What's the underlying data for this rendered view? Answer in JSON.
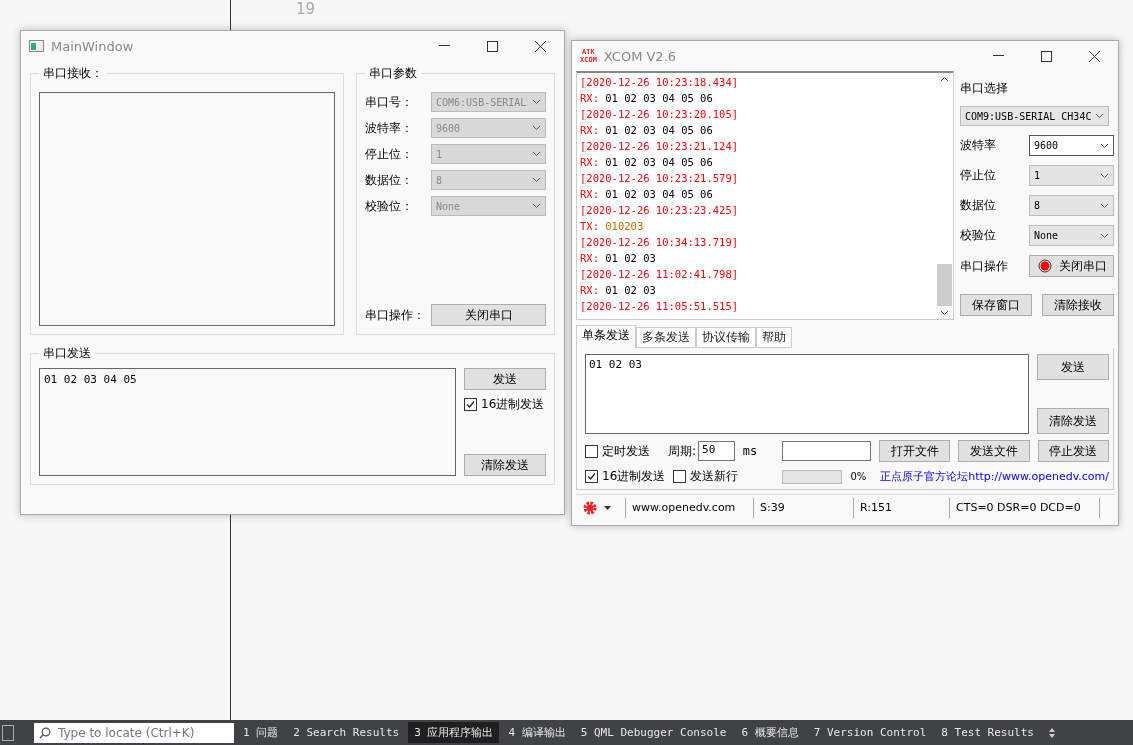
{
  "editor": {
    "line_number": "19"
  },
  "main_window": {
    "title": "MainWindow",
    "receive": {
      "title": "串口接收："
    },
    "params": {
      "title": "串口参数",
      "fields": [
        {
          "label": "串口号：",
          "value": "COM6:USB-SERIAL",
          "disabled": true
        },
        {
          "label": "波特率：",
          "value": "9600",
          "disabled": true
        },
        {
          "label": "停止位：",
          "value": "1",
          "disabled": true
        },
        {
          "label": "数据位：",
          "value": "8",
          "disabled": true
        },
        {
          "label": "校验位：",
          "value": "None",
          "disabled": true
        }
      ],
      "operation_label": "串口操作：",
      "operation_button": "关闭串口"
    },
    "send": {
      "title": "串口发送",
      "value": "01 02 03 04 05",
      "send_button": "发送",
      "hex_checkbox": {
        "label": "16进制发送",
        "checked": true
      },
      "clear_button": "清除发送"
    }
  },
  "xcom": {
    "title": "XCOM V2.6",
    "logo": [
      "ATK",
      "XCOM"
    ],
    "log": [
      {
        "kind": "time",
        "text": "[2020-12-26 10:23:18.434]"
      },
      {
        "kind": "rx",
        "prefix": "RX:",
        "data": "01 02 03 04 05 06"
      },
      {
        "kind": "time",
        "text": "[2020-12-26 10:23:20.105]"
      },
      {
        "kind": "rx",
        "prefix": "RX:",
        "data": "01 02 03 04 05 06"
      },
      {
        "kind": "time",
        "text": "[2020-12-26 10:23:21.124]"
      },
      {
        "kind": "rx",
        "prefix": "RX:",
        "data": "01 02 03 04 05 06"
      },
      {
        "kind": "time",
        "text": "[2020-12-26 10:23:21.579]"
      },
      {
        "kind": "rx",
        "prefix": "RX:",
        "data": "01 02 03 04 05 06"
      },
      {
        "kind": "time",
        "text": "[2020-12-26 10:23:23.425]"
      },
      {
        "kind": "tx",
        "prefix": "TX:",
        "data": "010203"
      },
      {
        "kind": "time",
        "text": "[2020-12-26 10:34:13.719]"
      },
      {
        "kind": "rx",
        "prefix": "RX:",
        "data": "01 02 03"
      },
      {
        "kind": "time",
        "text": "[2020-12-26 11:02:41.798]"
      },
      {
        "kind": "rx",
        "prefix": "RX:",
        "data": "01 02 03"
      },
      {
        "kind": "time",
        "text": "[2020-12-26 11:05:51.515]"
      }
    ],
    "port_label": "串口选择",
    "port_value": "COM9:USB-SERIAL CH34C",
    "fields": [
      {
        "label": "波特率",
        "value": "9600",
        "focused": true
      },
      {
        "label": "停止位",
        "value": "1",
        "focused": false
      },
      {
        "label": "数据位",
        "value": "8",
        "focused": false
      },
      {
        "label": "校验位",
        "value": "None",
        "focused": false
      }
    ],
    "operation_label": "串口操作",
    "operation_button": {
      "label": "关闭串口",
      "on": true
    },
    "save_button": "保存窗口",
    "clear_receive_button": "清除接收",
    "tabs": [
      {
        "label": "单条发送",
        "selected": true
      },
      {
        "label": "多条发送",
        "selected": false
      },
      {
        "label": "协议传输",
        "selected": false
      },
      {
        "label": "帮助",
        "selected": false
      }
    ],
    "send_value": "01 02 03",
    "send_button": "发送",
    "clear_send_button": "清除发送",
    "timed_send": {
      "label": "定时发送",
      "checked": false
    },
    "period_label": "周期:",
    "period_value": "50",
    "period_unit": "ms",
    "open_file_button": "打开文件",
    "send_file_button": "发送文件",
    "stop_send_button": "停止发送",
    "hex_send": {
      "label": "16进制发送",
      "checked": true
    },
    "newline": {
      "label": "发送新行",
      "checked": false
    },
    "progress": {
      "level": 0,
      "reading": "0%"
    },
    "forum_link": "正点原子官方论坛http://www.openedv.com/",
    "status": {
      "site": "www.openedv.com",
      "sent": "S:39",
      "received": "R:151",
      "lines": "CTS=0 DSR=0 DCD=0"
    }
  },
  "bottom_bar": {
    "search_placeholder": "Type to locate (Ctrl+K)",
    "tabs": [
      {
        "label": "1 问题",
        "selected": false
      },
      {
        "label": "2 Search Results",
        "selected": false
      },
      {
        "label": "3 应用程序输出",
        "selected": true
      },
      {
        "label": "4 编译输出",
        "selected": false
      },
      {
        "label": "5 QML Debugger Console",
        "selected": false
      },
      {
        "label": "6 概要信息",
        "selected": false
      },
      {
        "label": "7 Version Control",
        "selected": false
      },
      {
        "label": "8 Test Results",
        "selected": false
      }
    ]
  }
}
